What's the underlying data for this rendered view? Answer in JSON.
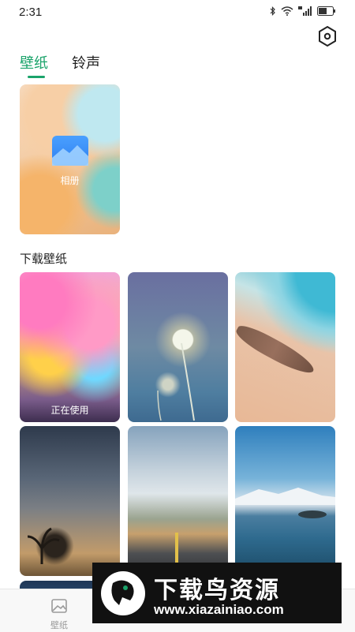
{
  "status_bar": {
    "time": "2:31",
    "icons": [
      "bluetooth-icon",
      "wifi-icon",
      "signal-4g-icon",
      "battery-icon"
    ]
  },
  "header": {
    "settings_icon": "hexagon-settings-icon"
  },
  "tabs": [
    {
      "label": "壁纸",
      "active": true
    },
    {
      "label": "铃声",
      "active": false
    }
  ],
  "album": {
    "label": "相册"
  },
  "download_section": {
    "title": "下载壁纸",
    "wallpapers": [
      {
        "label": "正在使用"
      },
      {
        "label": ""
      },
      {
        "label": ""
      },
      {
        "label": ""
      },
      {
        "label": ""
      },
      {
        "label": ""
      }
    ]
  },
  "bottom_nav": {
    "items": [
      {
        "label": "壁纸",
        "icon": "image-icon"
      },
      {
        "label": "",
        "icon": "nav-icon"
      },
      {
        "label": "",
        "icon": "nav-icon"
      }
    ]
  },
  "watermark": {
    "title": "下载鸟资源",
    "url": "www.xiazainiao.com"
  },
  "colors": {
    "accent": "#1aa36a",
    "album_icon": "#2e7ff0"
  }
}
